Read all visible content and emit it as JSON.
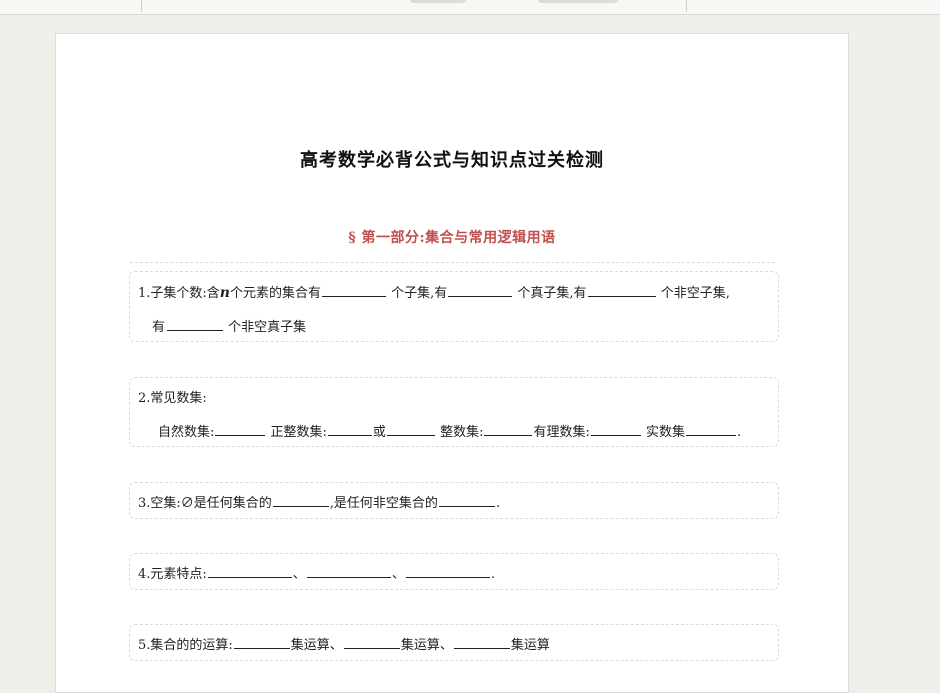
{
  "document": {
    "title": "高考数学必背公式与知识点过关检测",
    "section": "§ 第一部分:集合与常用逻辑用语"
  },
  "questions": {
    "q1": {
      "prefix": "1.子集个数:含",
      "var": "n",
      "t1": "个元素的集合有",
      "t2": "个子集,有",
      "t3": "个真子集,有",
      "t4": "个非空子集,",
      "t5": "有",
      "t6": "个非空真子集"
    },
    "q2": {
      "title": "2.常见数集:",
      "natural": "自然数集:",
      "pos_int": "正整数集:",
      "or": "或",
      "integer": "整数集:",
      "rational": "有理数集:",
      "real": "实数集",
      "end": "."
    },
    "q3": {
      "prefix": "3.空集:∅是任何集合的",
      "mid": ",是任何非空集合的",
      "end": "."
    },
    "q4": {
      "prefix": "4.元素特点:",
      "sep": "、",
      "end": "."
    },
    "q5": {
      "prefix": "5.集合的的运算:",
      "op": "集运算、",
      "op_last": "集运算"
    }
  }
}
